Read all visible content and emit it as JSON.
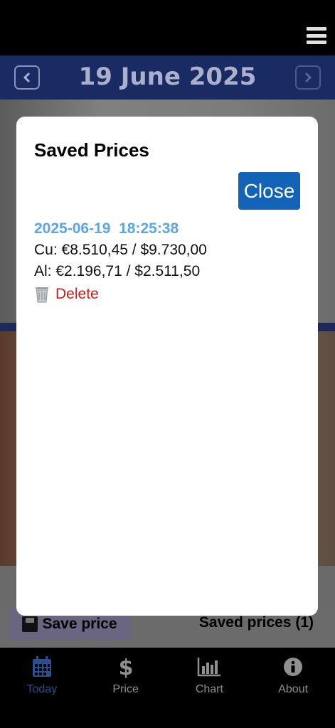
{
  "header": {
    "date": "19 June 2025",
    "menu_icon": "hamburger-icon",
    "prev_icon": "chevron-left-icon",
    "next_icon": "chevron-right-icon"
  },
  "actions": {
    "save_label": "Save price",
    "saved_prices_label": "Saved prices (1)"
  },
  "bottom_nav": [
    {
      "label": "Today",
      "icon": "calendar-icon",
      "active": true
    },
    {
      "label": "Price",
      "icon": "dollar-icon",
      "active": false
    },
    {
      "label": "Chart",
      "icon": "bar-chart-icon",
      "active": false
    },
    {
      "label": "About",
      "icon": "info-icon",
      "active": false
    }
  ],
  "modal": {
    "title": "Saved Prices",
    "close_label": "Close",
    "entries": [
      {
        "timestamp": "2025-06-19  18:25:38",
        "cu": "Cu: €8.510,45 / $9.730,00",
        "al": "Al: €2.196,71 / $2.511,50",
        "delete_label": "Delete"
      }
    ]
  },
  "colors": {
    "header_bg": "#1a2a63",
    "close_button": "#1363b8",
    "timestamp": "#5aa6e8",
    "delete": "#d11a1a",
    "nav_active": "#2a4f8e"
  }
}
